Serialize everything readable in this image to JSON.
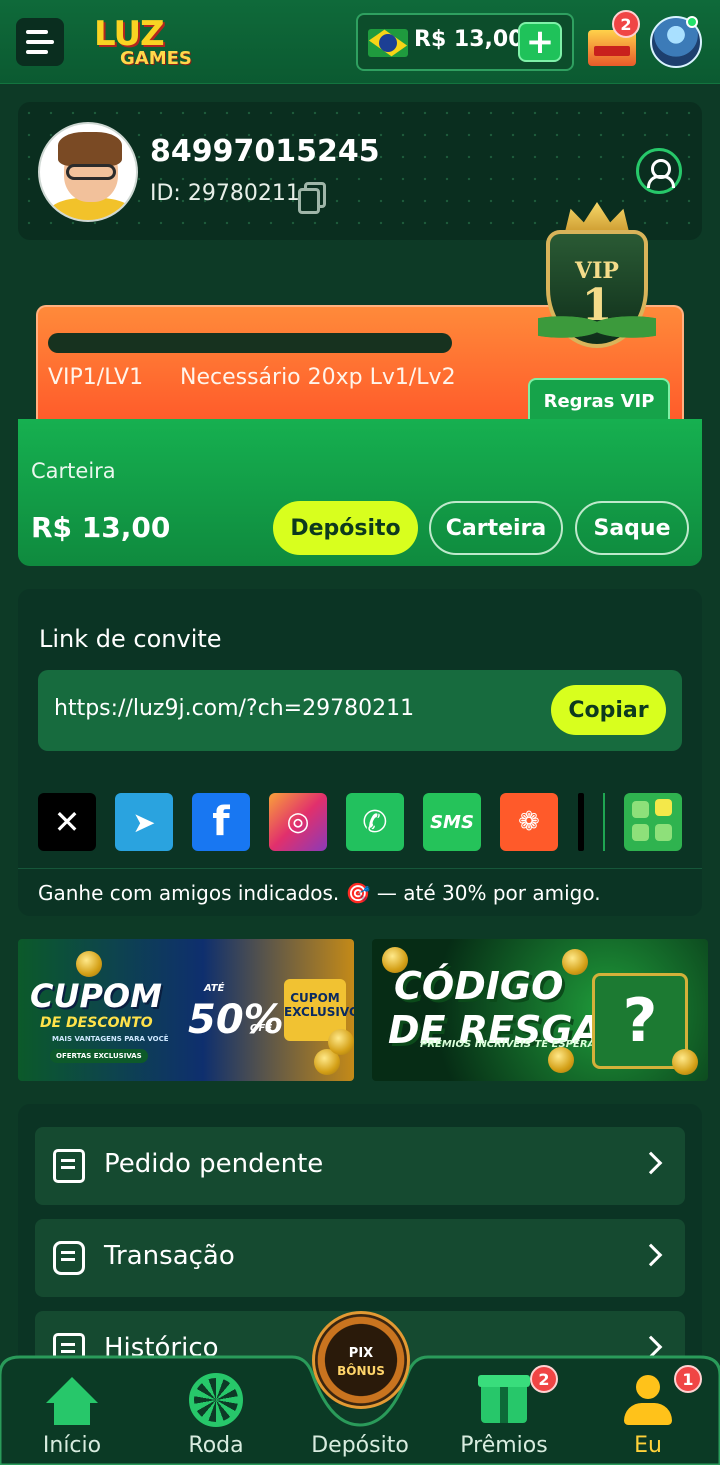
{
  "header": {
    "logo_text": "LUZ",
    "logo_sub": "GAMES",
    "balance": "R$ 13,00",
    "plus_label": "+",
    "gift_badge": "2",
    "flag": "brazil-flag-icon"
  },
  "profile": {
    "username": "84997015245",
    "user_id": "ID: 29780211"
  },
  "vip": {
    "progress": 0,
    "level": "VIP1/LV1",
    "requirement": "Necessário 20xp Lv1/Lv2",
    "rules_label": "Regras VIP",
    "emblem_label": "VIP",
    "emblem_number": "1"
  },
  "wallet": {
    "label": "Carteira",
    "amount": "R$ 13,00",
    "deposit_label": "Depósito",
    "wallet_label": "Carteira",
    "withdraw_label": "Saque"
  },
  "invite": {
    "title": "Link de convite",
    "url": "https://luz9j.com/?ch=29780211",
    "copy_label": "Copiar",
    "share": [
      "x",
      "telegram",
      "facebook",
      "instagram",
      "whatsapp",
      "sms",
      "kwai",
      "tiktok",
      "more"
    ],
    "sms_label": "SMS",
    "note": "Ganhe com amigos indicados. 🎯 — até 30% por amigo."
  },
  "banners": {
    "cupom": {
      "title": "CUPOM",
      "subtitle": "DE DESCONTO",
      "ate": "ATÉ",
      "percent": "50%",
      "off": "OFF",
      "tag": "CUPOM EXCLUSIVO",
      "small": "MAIS VANTAGENS PARA VOCÊ",
      "offers": "OFERTAS EXCLUSIVAS"
    },
    "resgate": {
      "title_line1": "CÓDIGO",
      "title_line2": "DE RESGATE",
      "subtitle": "PRÊMIOS INCRÍVEIS TE ESPERAM!",
      "question": "?"
    }
  },
  "menu": {
    "items": [
      {
        "label": "Pedido pendente"
      },
      {
        "label": "Transação"
      },
      {
        "label": "Histórico"
      }
    ]
  },
  "bottom_nav": {
    "items": [
      {
        "label": "Início"
      },
      {
        "label": "Roda"
      },
      {
        "label": "Depósito"
      },
      {
        "label": "Prêmios",
        "badge": "2"
      },
      {
        "label": "Eu",
        "badge": "1"
      }
    ],
    "center_pix": "PIX",
    "center_bonus": "BÔNUS"
  },
  "colors": {
    "accent_green": "#16b050",
    "button_yellow": "#d8ff1e",
    "vip_orange": "#ff5a2a",
    "background": "#0d3a26",
    "active_nav": "#ffd23a"
  }
}
